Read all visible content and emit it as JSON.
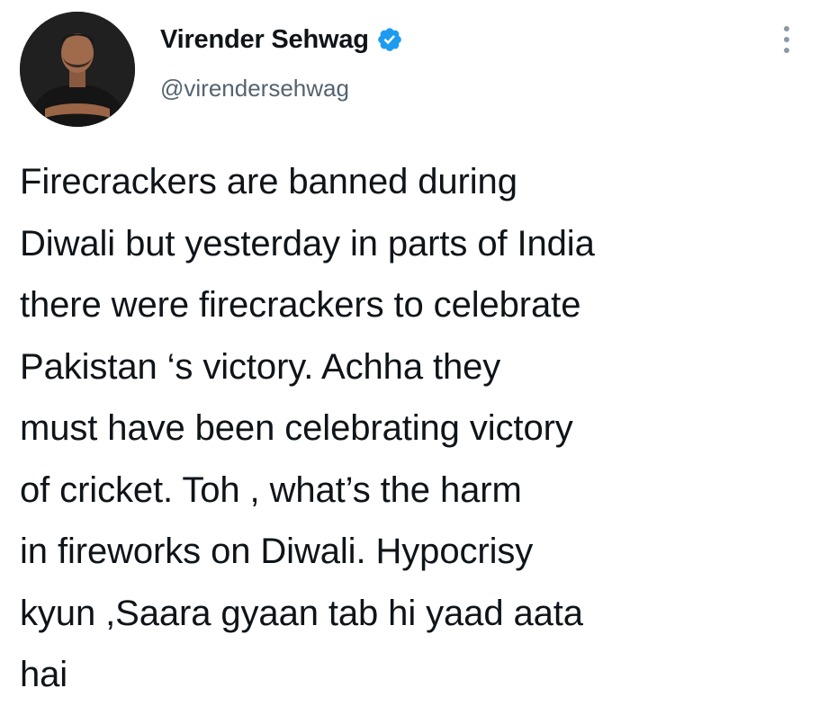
{
  "author": {
    "name": "Virender Sehwag",
    "handle": "@virendersehwag",
    "verified": true,
    "verified_color": "#1d9bf0"
  },
  "icons": {
    "avatar": "profile-photo",
    "verified": "verified-badge-icon",
    "more": "more-options-icon"
  },
  "tweet": {
    "lines": [
      "Firecrackers are banned during",
      "Diwali but yesterday in parts of India",
      "there were firecrackers to celebrate",
      "Pakistan ‘s victory. Achha they",
      "must have been celebrating victory",
      "of cricket. Toh , what’s the harm",
      "in fireworks on Diwali. Hypocrisy",
      "kyun ,Saara gyaan tab hi yaad aata",
      "hai"
    ]
  }
}
